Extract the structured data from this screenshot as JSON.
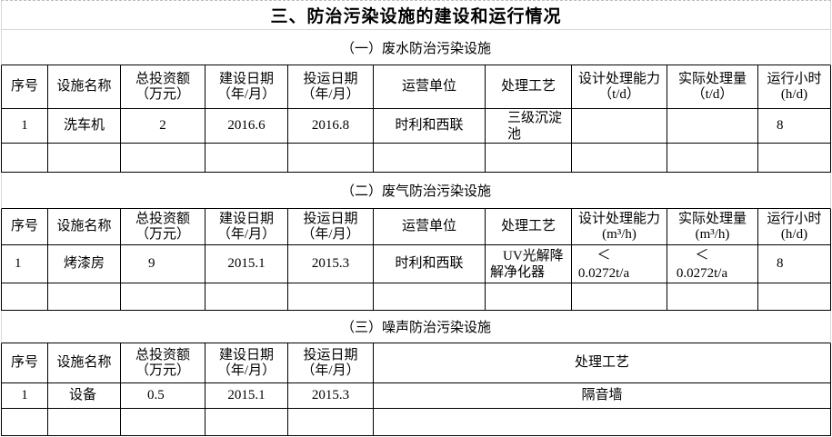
{
  "title": "三、防治污染设施的建设和运行情况",
  "water": {
    "heading": "（一）废水防治污染设施",
    "headers": {
      "serial": "序号",
      "name": "设施名称",
      "investment": {
        "label": "总投资额",
        "unit": "（万元）"
      },
      "build_date": {
        "label": "建设日期",
        "unit": "（年/月）"
      },
      "operation_date": {
        "label": "投运日期",
        "unit": "（年/月）"
      },
      "operator": "运营单位",
      "process": "处理工艺",
      "design_capacity": {
        "label": "设计处理能力",
        "unit": "（t/d）"
      },
      "actual_throughput": {
        "label": "实际处理量",
        "unit": "（t/d）"
      },
      "operating_hours": {
        "label": "运行小时",
        "unit": "(h/d)"
      }
    },
    "rows": [
      {
        "serial": "1",
        "name": "洗车机",
        "investment": "2",
        "build_date": "2016.6",
        "operation_date": "2016.8",
        "operator": "时利和西联",
        "process": "三级沉淀池",
        "operating_hours": "8"
      }
    ]
  },
  "gas": {
    "heading": "（二）废气防治污染设施",
    "headers": {
      "serial": "序号",
      "name": "设施名称",
      "investment": {
        "label": "总投资额",
        "unit": "（万元）"
      },
      "build_date": {
        "label": "建设日期",
        "unit": "（年/月）"
      },
      "operation_date": {
        "label": "投运日期",
        "unit": "（年/月）"
      },
      "operator": "运营单位",
      "process": "处理工艺",
      "design_capacity": {
        "label": "设计处理能力",
        "unit": "(m³/h)"
      },
      "actual_throughput": {
        "label": "实际处理量",
        "unit": "(m³/h)"
      },
      "operating_hours": {
        "label": "运行小时",
        "unit": "(h/d)"
      }
    },
    "rows": [
      {
        "serial": "1",
        "name": "烤漆房",
        "investment": "9",
        "build_date": "2015.1",
        "operation_date": "2015.3",
        "operator": "时利和西联",
        "process": "UV光解降解净化器",
        "design_capacity": "＜ 0.0272t/a",
        "actual_throughput": "＜ 0.0272t/a",
        "operating_hours": "8"
      }
    ]
  },
  "noise": {
    "heading": "（三）噪声防治污染设施",
    "headers": {
      "serial": "序号",
      "name": "设施名称",
      "investment": {
        "label": "总投资额",
        "unit": "（万元）"
      },
      "build_date": {
        "label": "建设日期",
        "unit": "（年/月）"
      },
      "operation_date": {
        "label": "投运日期",
        "unit": "（年/月）"
      },
      "process": "处理工艺"
    },
    "rows": [
      {
        "serial": "1",
        "name": "设备",
        "investment": "0.5",
        "build_date": "2015.1",
        "operation_date": "2015.3",
        "process": "隔音墙"
      }
    ]
  }
}
